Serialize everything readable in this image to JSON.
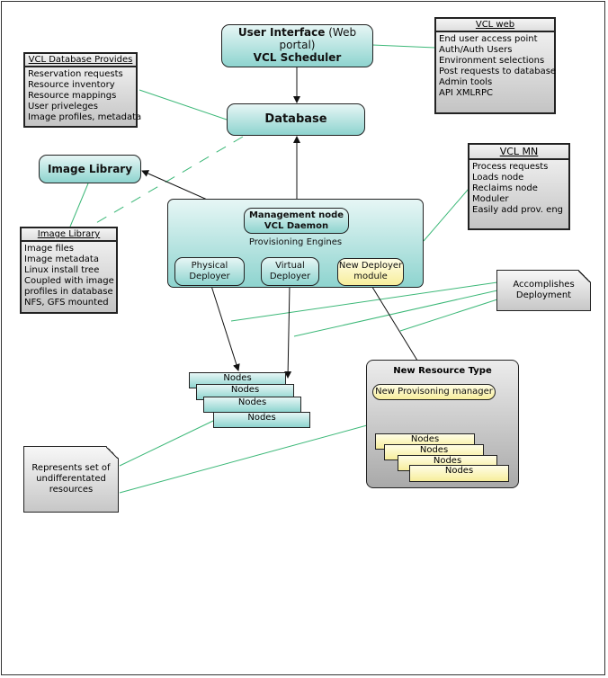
{
  "ui_box": {
    "title_bold": "User Interface",
    "title_rest": " (Web portal)",
    "subtitle": "VCL Scheduler"
  },
  "database_box": {
    "label": "Database"
  },
  "image_library_box": {
    "label": "Image Library"
  },
  "vcl_web_note": {
    "header": "VCL web",
    "items": [
      "End user access point",
      "Auth/Auth Users",
      "Environment selections",
      "Post requests to database",
      "Admin tools",
      "API XMLRPC"
    ]
  },
  "db_provides_note": {
    "header": "VCL Database Provides",
    "items": [
      "Reservation requests",
      "Resource inventory",
      "Resource mappings",
      "User priveleges",
      "Image profiles, metadata"
    ]
  },
  "image_lib_note": {
    "header": "Image Library",
    "items": [
      "Image files",
      "Image metadata",
      "Linux install tree",
      "Coupled with image",
      "profiles in database",
      "NFS, GFS mounted"
    ]
  },
  "vcl_mn_note": {
    "header": "VCL MN",
    "items": [
      "Process requests",
      "Loads node",
      "Reclaims node",
      "Moduler",
      "Easily add prov. eng"
    ]
  },
  "mgmt": {
    "line1": "Management node",
    "line2": "VCL Daemon",
    "engines_label": "Provisioning Engines",
    "physical": "Physical Deployer",
    "virtual": "Virtual Deployer",
    "new_deployer": "New Deployer module"
  },
  "nodes_stack": [
    "Nodes",
    "Nodes",
    "Nodes",
    "Nodes"
  ],
  "new_resource": {
    "title": "New Resource Type",
    "manager": "New Provisoning manager",
    "nodes": [
      "Nodes",
      "Nodes",
      "Nodes",
      "Nodes"
    ]
  },
  "accomplishes_note": "Accomplishes Deployment",
  "represents_note": "Represents set of undifferentated resources",
  "colors": {
    "teal_top": "#e6f6f5",
    "teal_bottom": "#8ed4cf",
    "yellow": "#f7ee9c",
    "link_green": "#3cb878"
  }
}
